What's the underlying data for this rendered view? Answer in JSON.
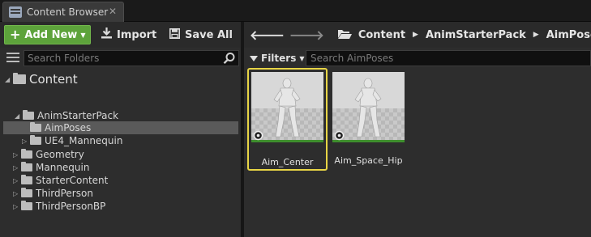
{
  "tab": {
    "title": "Content Browser",
    "close": "✕"
  },
  "toolbar": {
    "add_new": "Add New",
    "import": "Import",
    "save_all": "Save All"
  },
  "folder_search": {
    "placeholder": "Search Folders"
  },
  "tree": {
    "root": "Content",
    "items": [
      {
        "label": "AnimStarterPack",
        "expanded": true
      },
      {
        "label": "AimPoses",
        "selected": true
      },
      {
        "label": "UE4_Mannequin",
        "expanded": false
      },
      {
        "label": "Geometry",
        "expanded": false
      },
      {
        "label": "Mannequin",
        "expanded": false
      },
      {
        "label": "StarterContent",
        "expanded": false
      },
      {
        "label": "ThirdPerson",
        "expanded": false
      },
      {
        "label": "ThirdPersonBP",
        "expanded": false
      }
    ]
  },
  "path": {
    "crumbs": [
      "Content",
      "AnimStarterPack",
      "AimPoses"
    ]
  },
  "filters": {
    "label": "Filters",
    "search_placeholder": "Search AimPoses"
  },
  "assets": [
    {
      "name": "Aim_Center",
      "selected": true
    },
    {
      "name": "Aim_Space_Hip",
      "selected": false
    }
  ],
  "colors": {
    "add_new": "#5da33b",
    "selection_outline": "#e8d545",
    "panel_bg": "#2d2d2d"
  }
}
